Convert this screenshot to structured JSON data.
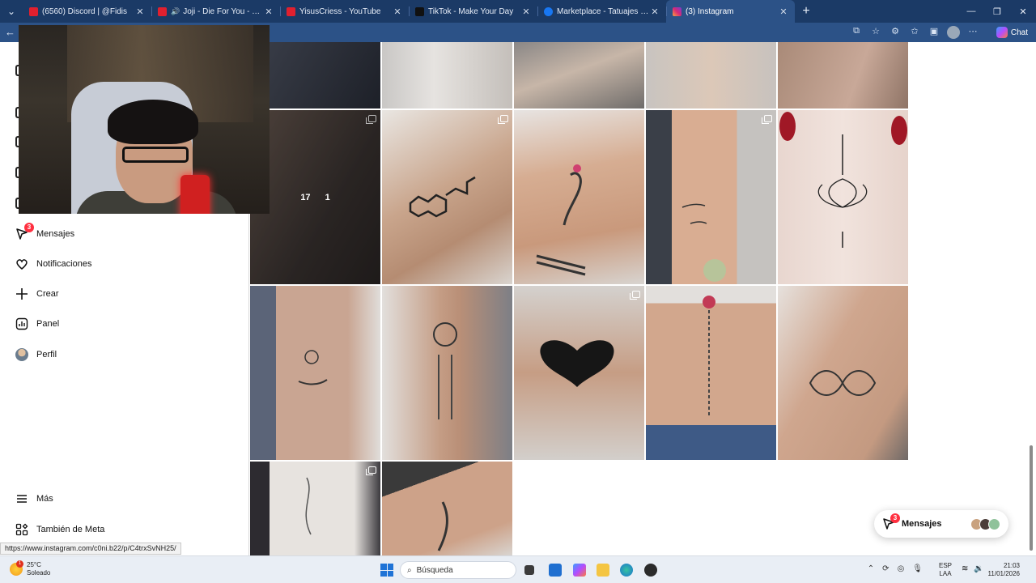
{
  "browser": {
    "tabs": [
      {
        "title": "(6560) Discord | @Fidis",
        "favicon_color": "#e0202f",
        "active": false,
        "audio": false
      },
      {
        "title": "Joji - Die For You - YouTube",
        "favicon_color": "#e0202f",
        "active": false,
        "audio": true
      },
      {
        "title": "YisusCriess - YouTube",
        "favicon_color": "#e0202f",
        "active": false,
        "audio": false
      },
      {
        "title": "TikTok - Make Your Day",
        "favicon_color": "#111111",
        "active": false,
        "audio": false
      },
      {
        "title": "Marketplace - Tatuajes | Facebook",
        "favicon_color": "#1877f2",
        "active": false,
        "audio": false
      },
      {
        "title": "(3) Instagram",
        "favicon_color": "#d62976",
        "active": true,
        "audio": false
      }
    ],
    "chat_label": "Chat"
  },
  "sidebar": {
    "items": [
      {
        "label": "Mensajes",
        "icon": "messenger-icon",
        "badge": "3"
      },
      {
        "label": "Notificaciones",
        "icon": "heart-icon"
      },
      {
        "label": "Crear",
        "icon": "plus-icon"
      },
      {
        "label": "Panel",
        "icon": "chart-icon"
      },
      {
        "label": "Perfil",
        "icon": "avatar"
      }
    ],
    "bottom_items": [
      {
        "label": "Más",
        "icon": "menu-icon"
      },
      {
        "label": "También de Meta",
        "icon": "meta-icon"
      }
    ]
  },
  "post_overlay": {
    "likes": "17",
    "comments": "1"
  },
  "messages_pill": {
    "label": "Mensajes",
    "badge": "3"
  },
  "status_url": "https://www.instagram.com/c0ni.b22/p/C4trxSvNH25/",
  "taskbar": {
    "weather_temp": "25°C",
    "weather_desc": "Soleado",
    "weather_badge": "1",
    "search_placeholder": "Búsqueda",
    "lang_line1": "ESP",
    "lang_line2": "LAA",
    "time": "21:03",
    "date": "11/01/2026"
  },
  "colors": {
    "brand_badge": "#ff3040",
    "tab_strip": "#1b3a66",
    "toolbar": "#2c5287"
  }
}
